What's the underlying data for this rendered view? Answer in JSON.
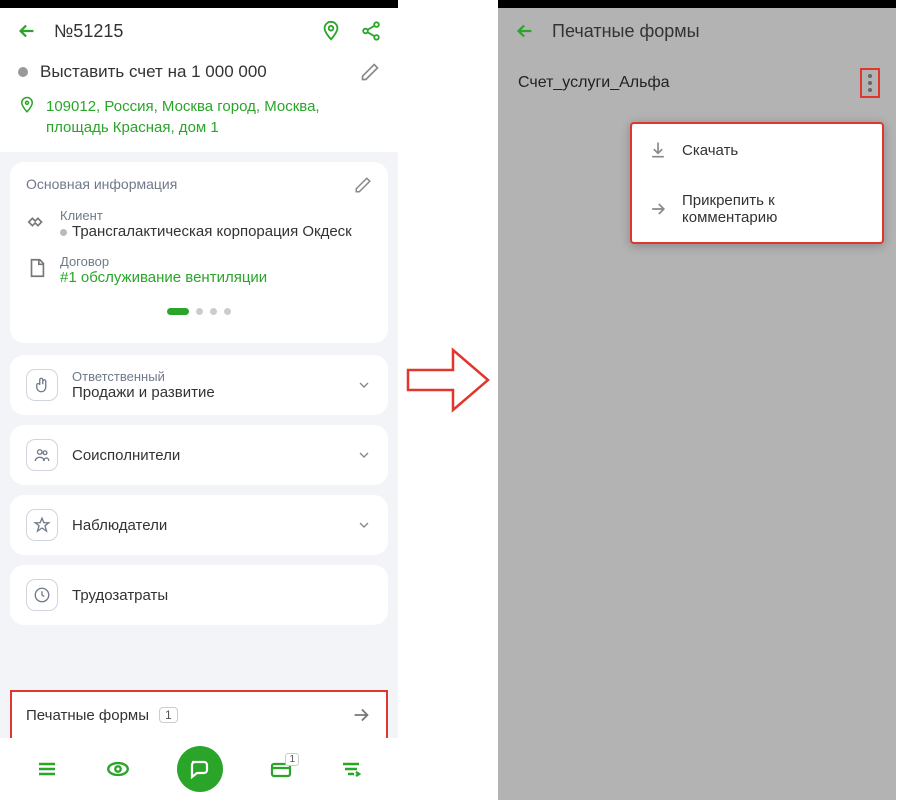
{
  "left": {
    "title": "№51215",
    "task": "Выставить счет на 1 000 000",
    "address": "109012, Россия, Москва город, Москва, площадь Красная, дом 1",
    "main_info_label": "Основная информация",
    "client_label": "Клиент",
    "client_value": "Трансгалактическая корпорация Окдеск",
    "contract_label": "Договор",
    "contract_value": "#1 обслуживание вентиляции",
    "responsible_label": "Ответственный",
    "responsible_value": "Продажи и развитие",
    "coexecutors": "Соисполнители",
    "observers": "Наблюдатели",
    "effort": "Трудозатраты",
    "print_forms": "Печатные формы",
    "print_forms_count": "1",
    "nav_badge": "1"
  },
  "right": {
    "title": "Печатные формы",
    "form_name": "Счет_услуги_Альфа",
    "download": "Скачать",
    "attach": "Прикрепить к комментарию"
  }
}
